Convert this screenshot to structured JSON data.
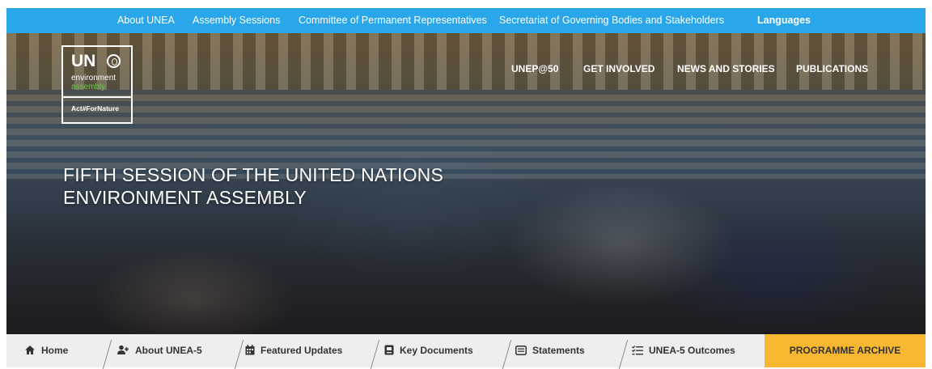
{
  "top_nav": {
    "items": [
      {
        "label": "About UNEA"
      },
      {
        "label": "Assembly Sessions"
      },
      {
        "label": "Committee of Permanent Representatives"
      },
      {
        "label": "Secretariat of Governing Bodies and Stakeholders"
      }
    ],
    "languages_label": "Languages",
    "background_color": "#2aa7ea"
  },
  "logo": {
    "un": "UN",
    "line1": "environment",
    "line2": "assembly",
    "tagline": "Act#ForNature",
    "accent_color": "#6bc44a"
  },
  "hero": {
    "nav": [
      {
        "label": "UNEP@50"
      },
      {
        "label": "GET INVOLVED"
      },
      {
        "label": "NEWS AND STORIES"
      },
      {
        "label": "PUBLICATIONS"
      }
    ],
    "title_line1": "FIFTH SESSION OF THE UNITED NATIONS",
    "title_line2": "ENVIRONMENT ASSEMBLY"
  },
  "bottom_nav": {
    "tabs": [
      {
        "label": "Home",
        "icon": "home-icon"
      },
      {
        "label": "About UNEA-5",
        "icon": "add-user-icon"
      },
      {
        "label": "Featured Updates",
        "icon": "calendar-icon"
      },
      {
        "label": "Key Documents",
        "icon": "document-icon"
      },
      {
        "label": "Statements",
        "icon": "statement-icon"
      },
      {
        "label": "UNEA-5 Outcomes",
        "icon": "list-icon"
      }
    ],
    "archive_label": "PROGRAMME ARCHIVE",
    "archive_color": "#f7b731"
  }
}
